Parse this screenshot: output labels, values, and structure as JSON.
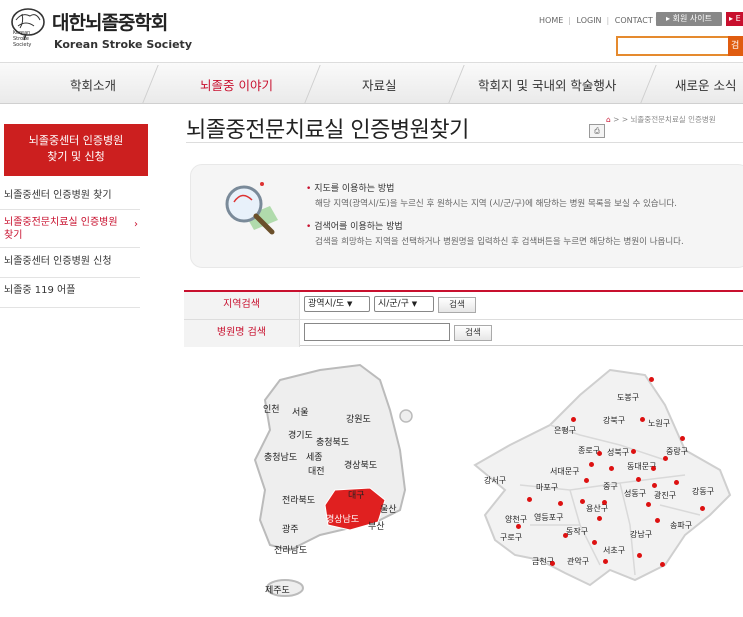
{
  "header": {
    "logo_ko": "대한뇌졸중학회",
    "logo_en": "Korean Stroke Society",
    "logo_small": [
      "Korean",
      "Stroke",
      "Society"
    ],
    "links": [
      "HOME",
      "LOGIN",
      "CONTACT US"
    ],
    "member_site": "회원 사이트",
    "red_btn": "E",
    "search_btn": "검"
  },
  "gnb": [
    "학회소개",
    "뇌졸중 이야기",
    "자료실",
    "학회지 및 국내외 학술행사",
    "새로운 소식"
  ],
  "sidebar": {
    "head": [
      "뇌졸중센터 인증병원",
      "찾기 및 신청"
    ],
    "items": [
      "뇌졸중센터 인증병원 찾기",
      "뇌졸중전문치료실 인증병원 찾기",
      "뇌졸중센터 인증병원 신청",
      "뇌졸중 119 어플"
    ]
  },
  "page": {
    "title": "뇌졸중전문치료실 인증병원찾기",
    "breadcrumb": "> > 뇌졸중전문치료실 인증병원",
    "print": "⎙"
  },
  "info": {
    "t1": "지도를 이용하는 방법",
    "d1": "해당 지역(광역시/도)을 누르신 후 원하시는 지역 (시/군/구)에 해당하는 병원 목록을 보실 수 있습니다.",
    "t2": "검색어를 이용하는 방법",
    "d2": "검색을 희망하는 지역을 선택하거나 병원명을 입력하신 후 검색버튼을 누르면 해당하는 병원이 나옵니다."
  },
  "form": {
    "region_label": "지역검색",
    "name_label": "병원명 검색",
    "sel1": "광역시/도",
    "sel2": "시/군/구",
    "search": "검색"
  },
  "map_korea": [
    "인천",
    "서울",
    "강원도",
    "경기도",
    "충청북도",
    "충청남도",
    "세종",
    "대전",
    "경상북도",
    "전라북도",
    "대구",
    "울산",
    "경상남도",
    "부산",
    "광주",
    "전라남도",
    "제주도"
  ],
  "map_seoul": [
    "도봉구",
    "강북구",
    "노원구",
    "은평구",
    "종로구",
    "성북구",
    "중랑구",
    "서대문구",
    "동대문구",
    "강서구",
    "마포구",
    "중구",
    "성동구",
    "광진구",
    "강동구",
    "양천구",
    "영등포구",
    "용산구",
    "송파구",
    "구로구",
    "동작구",
    "강남구",
    "서초구",
    "금천구",
    "관악구"
  ],
  "colors": {
    "accent": "#c8102e",
    "selected_region": "#e02020"
  }
}
